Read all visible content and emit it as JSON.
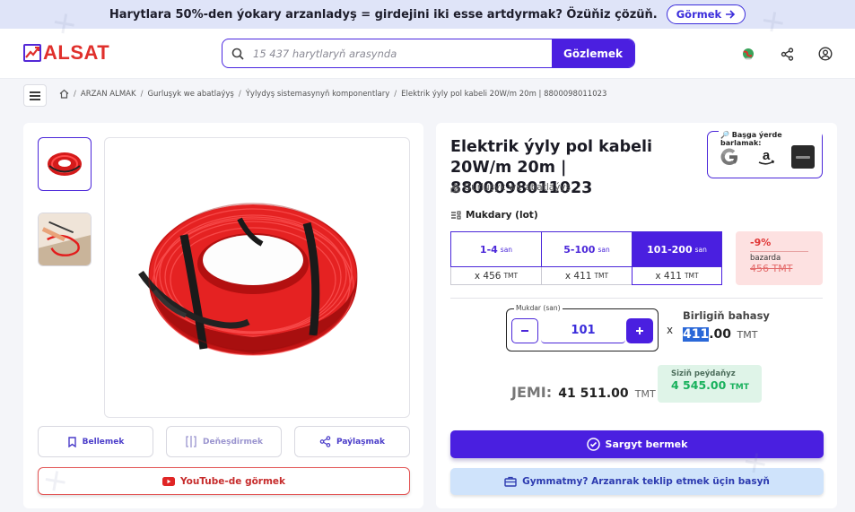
{
  "banner": {
    "text": "Harytlara 50%-den ýokary arzanladyş = girdejini iki esse artdyrmak? Özüňiz çözüň.",
    "button_label": "Görmek"
  },
  "header": {
    "logo_text": "ALSAT",
    "search_placeholder": "15 437 harytlaryň arasynda",
    "search_button": "Gözlemek"
  },
  "breadcrumb": [
    "ARZAN ALMAK",
    "Gurluşyk we abatlaýyş",
    "Ýylydyş sistemasynyň komponentlary",
    "Elektrik ýyly pol kabeli 20W/m 20m | 8800098011023"
  ],
  "product": {
    "title": "Elektrik ýyly pol kabeli 20W/m 20m | 8800098011023",
    "category": "Gurluşyk we abatlaýyş",
    "elsewhere_label": "Başga ýerde barlamak:",
    "quantity_label": "Mukdary (lot)",
    "tiers": [
      {
        "range": "1-4",
        "unit": "san",
        "price": "x 456",
        "currency": "TMT"
      },
      {
        "range": "5-100",
        "unit": "san",
        "price": "x 411",
        "currency": "TMT"
      },
      {
        "range": "101-200",
        "unit": "san",
        "price": "x 411",
        "currency": "TMT"
      }
    ],
    "discount": {
      "percent": "-9%",
      "label": "bazarda",
      "old_price": "456 TMT"
    },
    "qty_field_label": "Mukdar (san)",
    "qty_value": "101",
    "times": "x",
    "unit_price_label": "Birligiň bahasy",
    "unit_price_int": "411",
    "unit_price_dec": ".00",
    "unit_price_cur": "TMT",
    "total_label": "JEMI:",
    "total_value": "41 511.00",
    "total_cur": "TMT",
    "profit_label": "Siziň peýdaňyz",
    "profit_value": "4 545.00",
    "profit_cur": "TMT",
    "order_button": "Sargyt bermek",
    "offer_button": "Gymmatmy? Arzanrak teklip etmek üçin basyň"
  },
  "actions": {
    "bookmark": "Bellemek",
    "compare": "Deňeşdirmek",
    "share": "Paýlaşmak",
    "youtube": "YouTube-de görmek"
  },
  "colors": {
    "accent": "#4a1fe0",
    "brand_red": "#e0302c",
    "profit_green": "#18b15c",
    "discount_red": "#e03535"
  }
}
